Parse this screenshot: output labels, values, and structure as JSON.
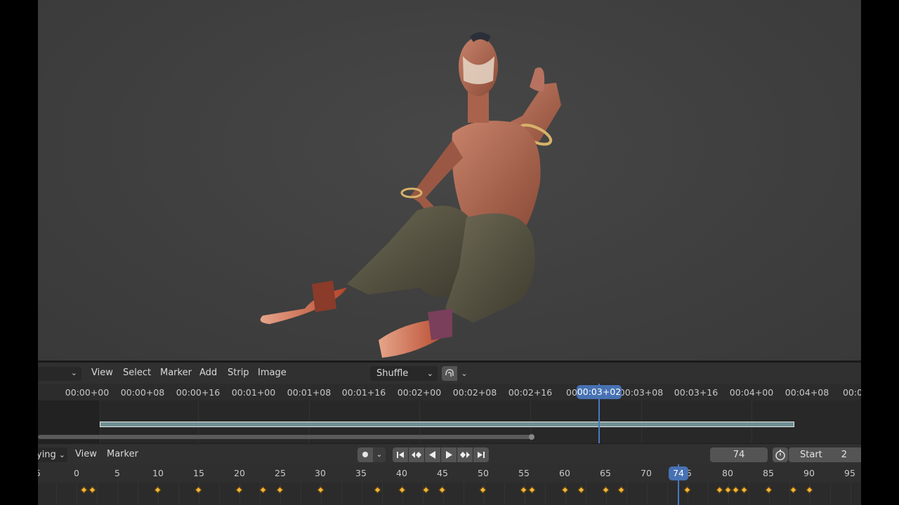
{
  "sequencer": {
    "menu": {
      "view": "View",
      "select": "Select",
      "marker": "Marker",
      "add": "Add",
      "strip": "Strip",
      "image": "Image"
    },
    "overlap_mode": "Shuffle",
    "timecodes": [
      "00:00+00",
      "00:00+08",
      "00:00+16",
      "00:01+00",
      "00:01+08",
      "00:01+16",
      "00:02+00",
      "00:02+08",
      "00:02+16",
      "00",
      "00:03+08",
      "00:03+16",
      "00:04+00",
      "00:04+08",
      "00:0"
    ],
    "current_timecode": "00:03+02"
  },
  "timeline": {
    "playback_dropdown": "ying",
    "menu": {
      "view": "View",
      "marker": "Marker"
    },
    "current_frame": "74",
    "start_label": "Start",
    "start_value": "2",
    "frame_labels": [
      "5",
      "0",
      "5",
      "10",
      "15",
      "20",
      "25",
      "30",
      "35",
      "40",
      "45",
      "50",
      "55",
      "60",
      "65",
      "70",
      "5",
      "80",
      "85",
      "90",
      "95"
    ],
    "playhead_frame": "74",
    "icons": [
      "record-icon",
      "chevron-down-icon",
      "jump-start-icon",
      "prev-keyframe-icon",
      "play-reverse-icon",
      "play-icon",
      "next-keyframe-icon",
      "jump-end-icon",
      "stopwatch-icon"
    ]
  },
  "colors": {
    "accent": "#4772b3",
    "keyframe": "#f2b43c",
    "strip": "#6f8f93"
  }
}
